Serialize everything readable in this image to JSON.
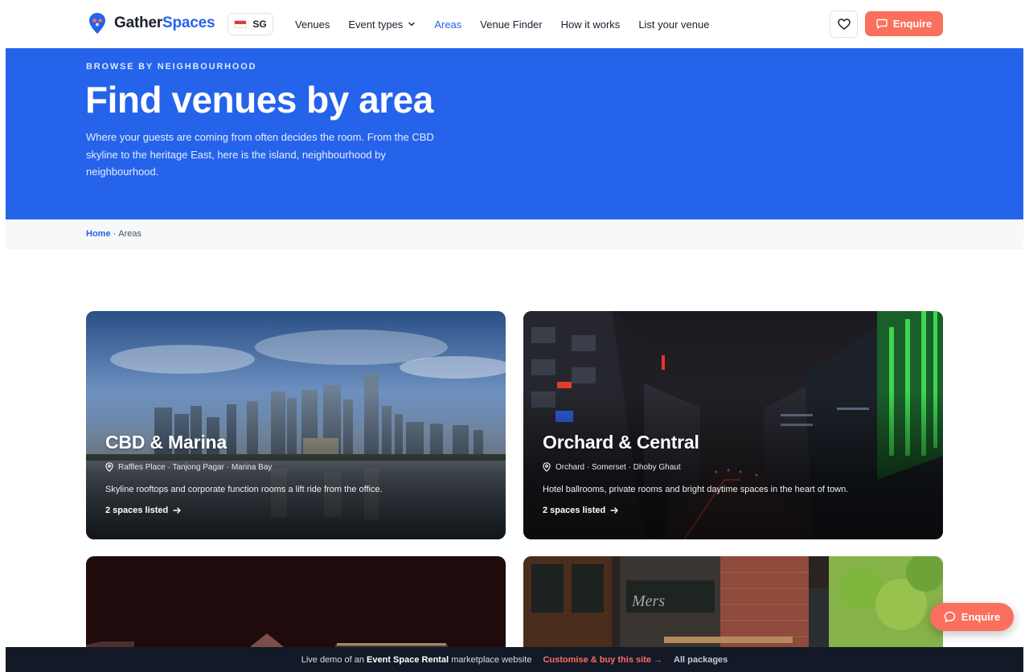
{
  "brand": {
    "name_part1": "Gather",
    "name_part2": "Spaces",
    "accent": "#2563eb",
    "cta_color": "#fb6f5d"
  },
  "country": {
    "code": "SG"
  },
  "nav": {
    "items": [
      {
        "label": "Venues"
      },
      {
        "label": "Event types"
      },
      {
        "label": "Areas"
      },
      {
        "label": "Venue Finder"
      },
      {
        "label": "How it works"
      },
      {
        "label": "List your venue"
      }
    ],
    "active": "Areas"
  },
  "header": {
    "enquire_label": "Enquire",
    "favorites_icon": "heart-icon"
  },
  "hero": {
    "eyebrow": "BROWSE BY NEIGHBOURHOOD",
    "title": "Find venues by area",
    "description": "Where your guests are coming from often decides the room. From the CBD skyline to the heritage East, here is the island, neighbourhood by neighbourhood."
  },
  "breadcrumb": {
    "home": "Home",
    "separator": "·",
    "current": "Areas"
  },
  "cards": [
    {
      "title": "CBD & Marina",
      "locations": "Raffles Place · Tanjong Pagar · Marina Bay",
      "description": "Skyline rooftops and corporate function rooms a lift ride from the office.",
      "count": "2 spaces listed"
    },
    {
      "title": "Orchard & Central",
      "locations": "Orchard · Somerset · Dhoby Ghaut",
      "description": "Hotel ballrooms, private rooms and bright daytime spaces in the heart of town.",
      "count": "2 spaces listed"
    },
    {
      "title": ""
    },
    {
      "title": ""
    }
  ],
  "floating": {
    "enquire_label": "Enquire"
  },
  "demo_bar": {
    "prefix": "Live demo of an",
    "product": "Event Space Rental",
    "suffix": "marketplace website",
    "cta": "Customise & buy this site →",
    "packages": "All packages"
  }
}
